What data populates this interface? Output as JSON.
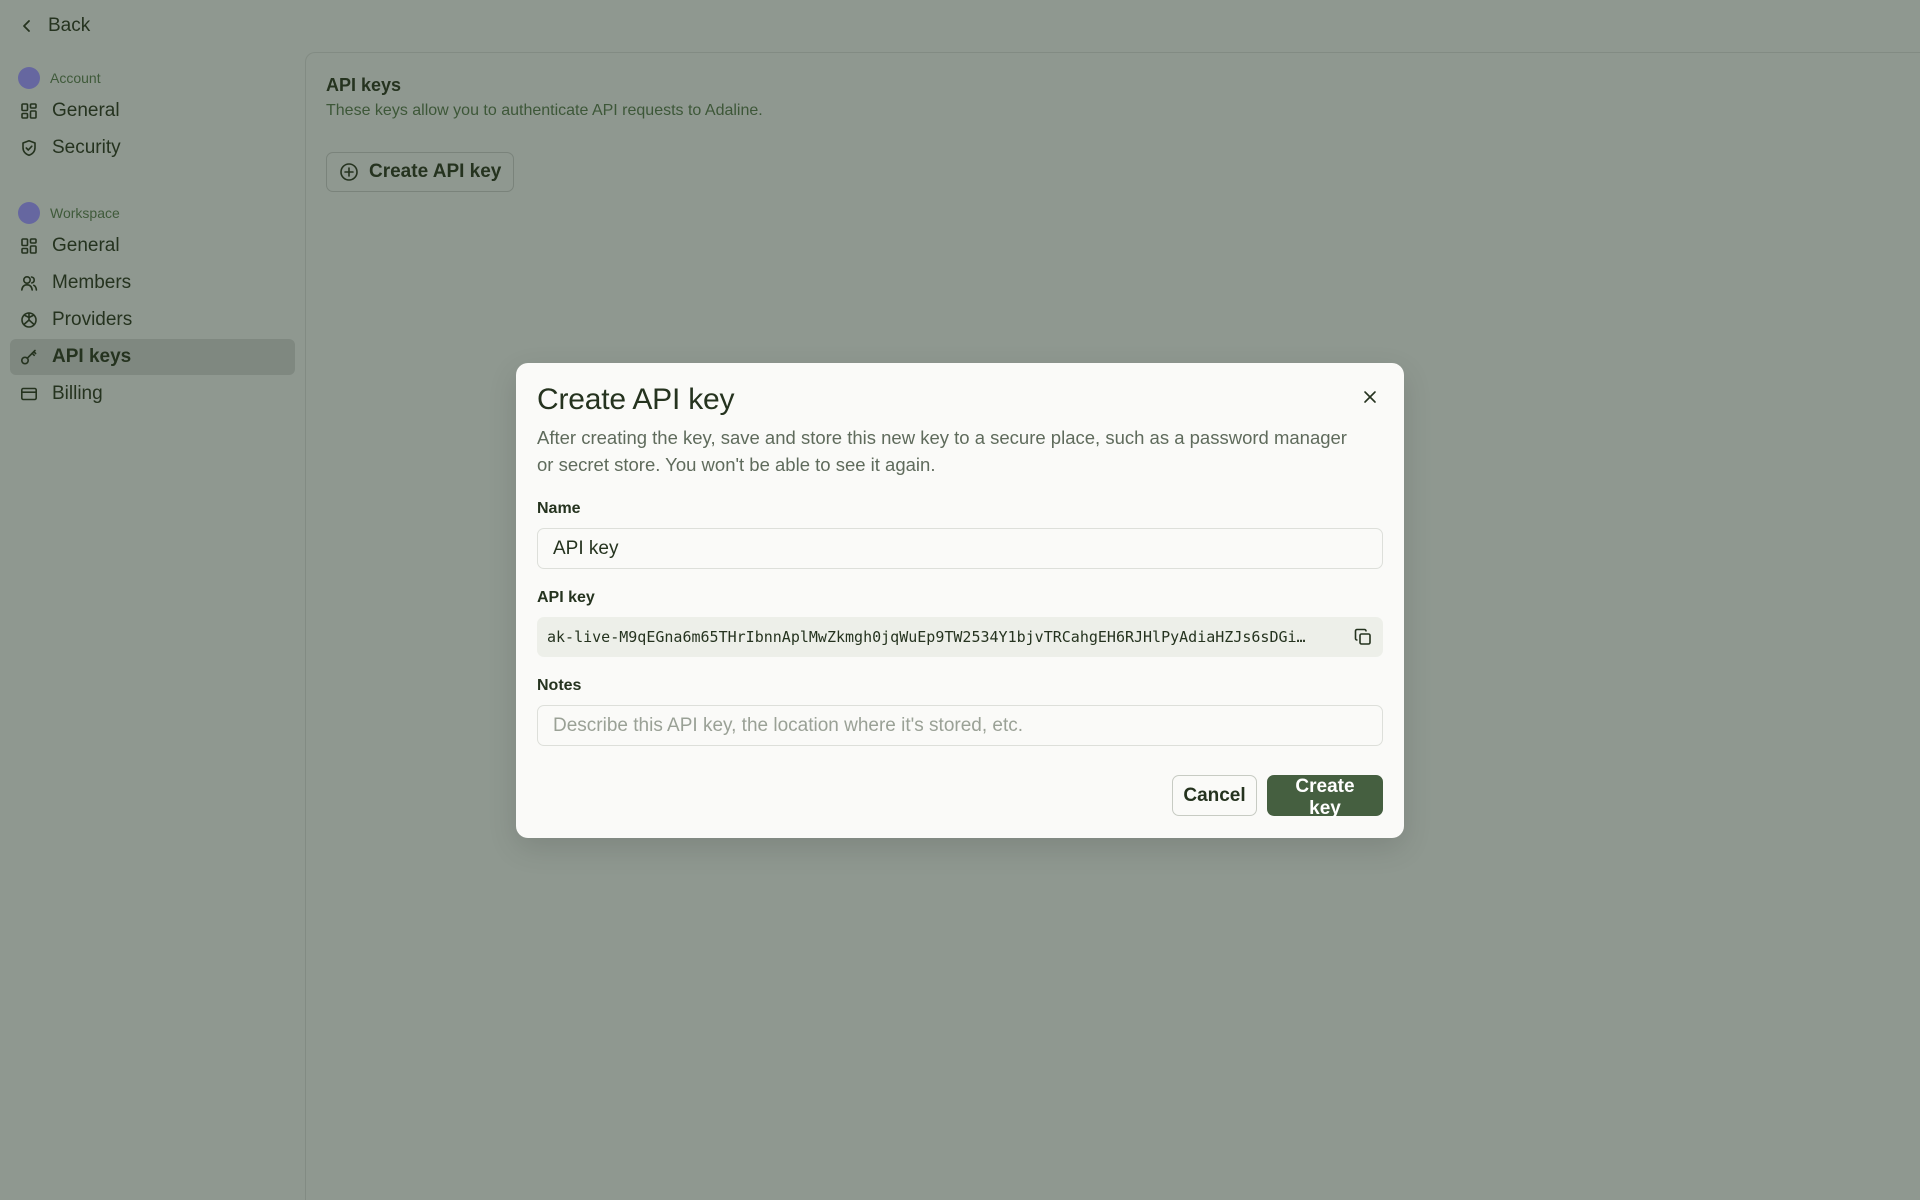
{
  "topbar": {
    "back_label": "Back"
  },
  "sidebar": {
    "account_section": {
      "label": "Account",
      "items": [
        {
          "label": "General",
          "icon": "grid-icon"
        },
        {
          "label": "Security",
          "icon": "shield-icon"
        }
      ]
    },
    "workspace_section": {
      "label": "Workspace",
      "items": [
        {
          "label": "General",
          "icon": "grid-icon"
        },
        {
          "label": "Members",
          "icon": "users-icon"
        },
        {
          "label": "Providers",
          "icon": "providers-icon"
        },
        {
          "label": "API keys",
          "icon": "key-icon",
          "active": true
        },
        {
          "label": "Billing",
          "icon": "credit-card-icon"
        }
      ]
    }
  },
  "main": {
    "title": "API keys",
    "description": "These keys allow you to authenticate API requests to Adaline.",
    "create_button_label": "Create API key"
  },
  "modal": {
    "title": "Create API key",
    "subtitle": "After creating the key, save and store this new key to a secure place, such as a password manager or secret store. You won't be able to see it again.",
    "name_label": "Name",
    "name_value": "API key",
    "api_key_label": "API key",
    "api_key_value": "ak-live-M9qEGna6m65THrIbnnAplMwZkmgh0jqWuEp9TW2534Y1bjvTRCahgEH6RJHlPyAdiaHZJs6sDGi…",
    "notes_label": "Notes",
    "notes_placeholder": "Describe this API key, the location where it's stored, etc.",
    "cancel_label": "Cancel",
    "submit_label": "Create key"
  },
  "colors": {
    "backdrop": "#8f9890",
    "accent": "#455f40",
    "avatar": "#6667a0",
    "text": "#25331f"
  }
}
